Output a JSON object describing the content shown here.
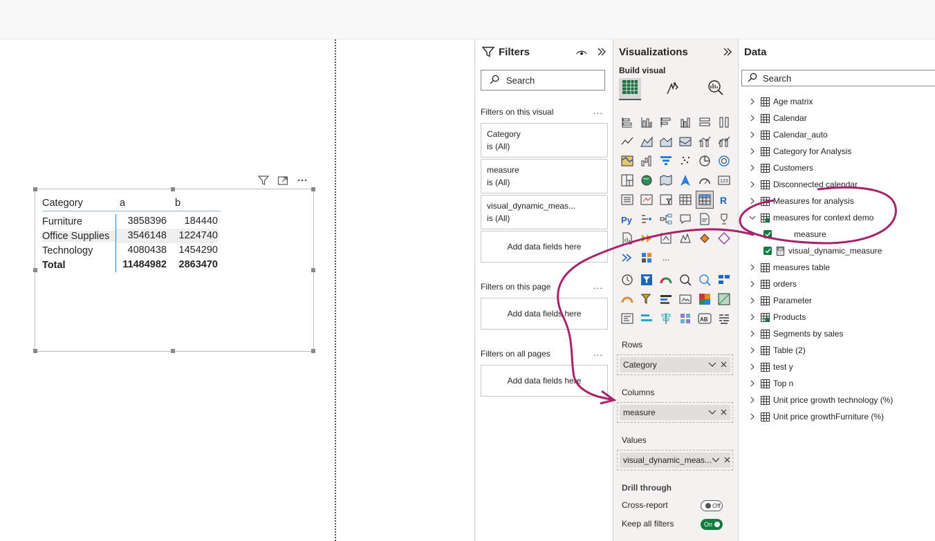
{
  "matrix": {
    "headers": [
      "Category",
      "a",
      "b"
    ],
    "rows": [
      {
        "category": "Furniture",
        "a": "3858396",
        "b": "184440"
      },
      {
        "category": "Office Supplies",
        "a": "3546148",
        "b": "1224740"
      },
      {
        "category": "Technology",
        "a": "4080438",
        "b": "1454290"
      }
    ],
    "total": {
      "label": "Total",
      "a": "11484982",
      "b": "2863470"
    }
  },
  "filters": {
    "title": "Filters",
    "search_placeholder": "Search",
    "on_visual_label": "Filters on this visual",
    "cards": [
      {
        "name": "Category",
        "state": "is (All)"
      },
      {
        "name": "measure",
        "state": "is (All)"
      },
      {
        "name": "visual_dynamic_meas...",
        "state": "is (All)"
      }
    ],
    "add_fields": "Add data fields here",
    "on_page_label": "Filters on this page",
    "on_all_pages_label": "Filters on all pages"
  },
  "viz": {
    "title": "Visualizations",
    "build_label": "Build visual",
    "rows_label": "Rows",
    "rows_field": "Category",
    "columns_label": "Columns",
    "columns_field": "measure",
    "values_label": "Values",
    "values_field": "visual_dynamic_meas...",
    "drill_label": "Drill through",
    "cross_report_label": "Cross-report",
    "cross_report_state": "Off",
    "keep_filters_label": "Keep all filters",
    "keep_filters_state": "On",
    "more": "..."
  },
  "data": {
    "title": "Data",
    "search_placeholder": "Search",
    "tables": [
      "Age matrix",
      "Calendar",
      "Calendar_auto",
      "Category for Analysis",
      "Customers",
      "Disconnected calendar",
      "Measures for analysis",
      "measures for context demo"
    ],
    "expanded_children": [
      "measure",
      "visual_dynamic_measure"
    ],
    "tables_after": [
      "measures table",
      "orders",
      "Parameter",
      "Products",
      "Segments by sales",
      "Table (2)",
      "test y",
      "Top n",
      "Unit price growth technology (%)",
      "Unit price growthFurniture (%)"
    ]
  },
  "colors": {
    "annotation": "#a8226b",
    "accent_green": "#107c41",
    "header_line": "#1b7fc4"
  }
}
